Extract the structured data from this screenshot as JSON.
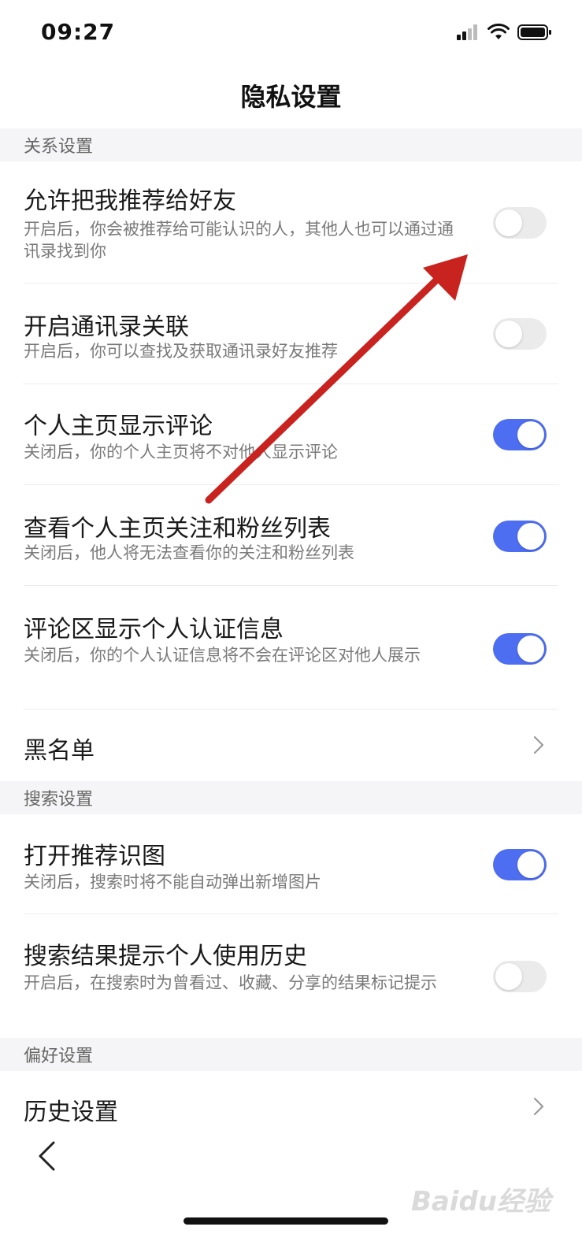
{
  "status_bar": {
    "time": "09:27"
  },
  "page": {
    "title": "隐私设置"
  },
  "sections": {
    "relation": {
      "header": "关系设置"
    },
    "search": {
      "header": "搜索设置"
    },
    "preference": {
      "header": "偏好设置"
    }
  },
  "rows": {
    "recommend_me": {
      "title": "允许把我推荐给好友",
      "desc": "开启后，你会被推荐给可能认识的人，其他人也可以通过通讯录找到你",
      "enabled": false
    },
    "contacts_link": {
      "title": "开启通讯录关联",
      "desc": "开启后，你可以查找及获取通讯录好友推荐",
      "enabled": false
    },
    "profile_comments": {
      "title": "个人主页显示评论",
      "desc": "关闭后，你的个人主页将不对他人显示评论",
      "enabled": true
    },
    "follow_fans_list": {
      "title": "查看个人主页关注和粉丝列表",
      "desc": "关闭后，他人将无法查看你的关注和粉丝列表",
      "enabled": true
    },
    "comment_cert": {
      "title": "评论区显示个人认证信息",
      "desc": "关闭后，你的个人认证信息将不会在评论区对他人展示",
      "enabled": true
    },
    "blacklist": {
      "title": "黑名单"
    },
    "recommend_image": {
      "title": "打开推荐识图",
      "desc": "关闭后，搜索时将不能自动弹出新增图片",
      "enabled": true
    },
    "search_history": {
      "title": "搜索结果提示个人使用历史",
      "desc": "开启后，在搜索时为曾看过、收藏、分享的结果标记提示",
      "enabled": false
    },
    "history_settings": {
      "title": "历史设置"
    }
  },
  "watermark": {
    "text": "Baidu经验"
  },
  "colors": {
    "toggle_on": "#4e6ef2",
    "toggle_off": "#ebebeb",
    "arrow": "#c8231e",
    "section_bg": "#f5f5f7"
  }
}
